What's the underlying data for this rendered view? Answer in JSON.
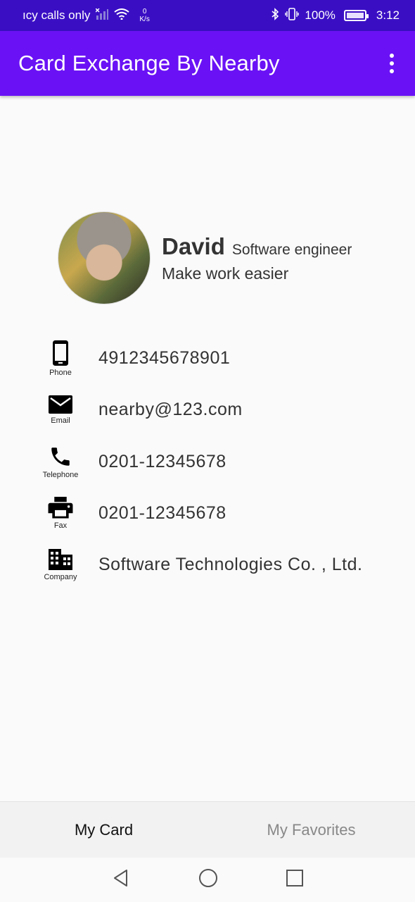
{
  "status_bar": {
    "carrier_text": "ıcy calls only",
    "speed_value": "0",
    "speed_unit": "K/s",
    "battery_percent": "100%",
    "time": "3:12"
  },
  "app_bar": {
    "title": "Card Exchange By Nearby"
  },
  "profile": {
    "name": "David",
    "job_title": "Software engineer",
    "motto": "Make work easier"
  },
  "contacts": [
    {
      "label": "Phone",
      "value": "4912345678901",
      "icon": "phone-icon"
    },
    {
      "label": "Email",
      "value": "nearby@123.com",
      "icon": "email-icon"
    },
    {
      "label": "Telephone",
      "value": "0201-12345678",
      "icon": "telephone-icon"
    },
    {
      "label": "Fax",
      "value": "0201-12345678",
      "icon": "fax-icon"
    },
    {
      "label": "Company",
      "value": "Software Technologies Co. , Ltd.",
      "icon": "company-icon"
    }
  ],
  "bottom_tabs": {
    "my_card": "My Card",
    "my_favorites": "My Favorites"
  },
  "colors": {
    "status_bar": "#3a0fc4",
    "app_bar": "#6a12f5",
    "background": "#fafafa"
  }
}
